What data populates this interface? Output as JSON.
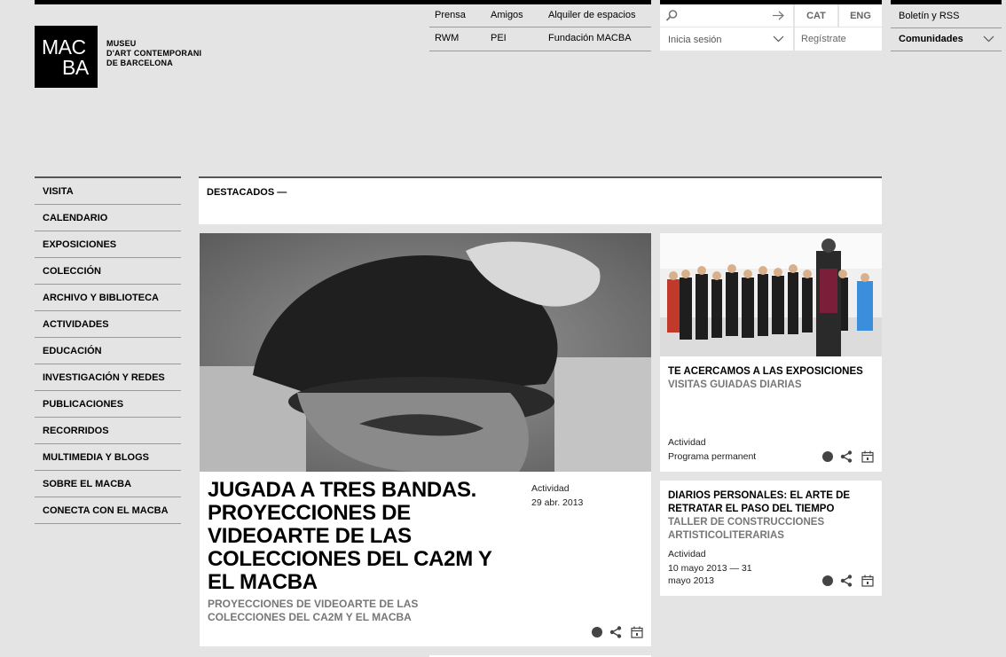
{
  "logo": {
    "mark_line1": "MAC",
    "mark_line2": "BA",
    "name_lines": [
      "MUSEU",
      "D'ART CONTEMPORANI",
      "DE BARCELONA"
    ]
  },
  "toplinks": {
    "row1": [
      "Prensa",
      "Amigos",
      "Alquiler de espacios"
    ],
    "row2": [
      "RWM",
      "PEI",
      "Fundación MACBA"
    ]
  },
  "search": {
    "placeholder": ""
  },
  "languages": [
    "CAT",
    "ENG"
  ],
  "login": {
    "label": "Inicia sesión"
  },
  "register": {
    "label": "Regístrate"
  },
  "rightlinks": {
    "newsletter": "Boletín y RSS",
    "communities": "Comunidades"
  },
  "leftnav": [
    "VISITA",
    "CALENDARIO",
    "EXPOSICIONES",
    "COLECCIÓN",
    "ARCHIVO Y BIBLIOTECA",
    "ACTIVIDADES",
    "EDUCACIÓN",
    "INVESTIGACIÓN Y REDES",
    "PUBLICACIONES",
    "RECORRIDOS",
    "MULTIMEDIA Y BLOGS",
    "SOBRE EL MACBA",
    "CONECTA CON EL MACBA"
  ],
  "destacados": {
    "title": "DESTACADOS —"
  },
  "main_card": {
    "title": "JUGADA A TRES BANDAS. PROYECCIONES DE VIDEOARTE DE LAS COLECCIONES DEL CA2M Y EL MACBA",
    "subtitle": "PROYECCIONES DE VIDEOARTE DE LAS COLECCIONES DEL CA2M Y EL MACBA",
    "type": "Actividad",
    "date": "29 abr. 2013"
  },
  "side_cards": [
    {
      "title": "TE ACERCAMOS A LAS EXPOSICIONES",
      "subtitle": "VISITAS GUIADAS DIARIAS",
      "type": "Actividad",
      "date": "Programa permanent"
    },
    {
      "title": "DIARIOS PERSONALES: EL ARTE DE RETRATAR EL PASO DEL TIEMPO",
      "subtitle": "TALLER DE CONSTRUCCIONES ARTISTICOLITERARIAS",
      "type": "Actividad",
      "date_line1": "10 mayo 2013 — 31",
      "date_line2": "mayo 2013"
    }
  ],
  "colors": {
    "background": "#e4e4e4",
    "card": "#ffffff",
    "subtitle_gray": "#777777",
    "rule": "#555555"
  },
  "icons": [
    "search-icon",
    "arrow-right-icon",
    "chevron-down-icon",
    "dot-icon",
    "share-icon",
    "calendar-icon"
  ]
}
